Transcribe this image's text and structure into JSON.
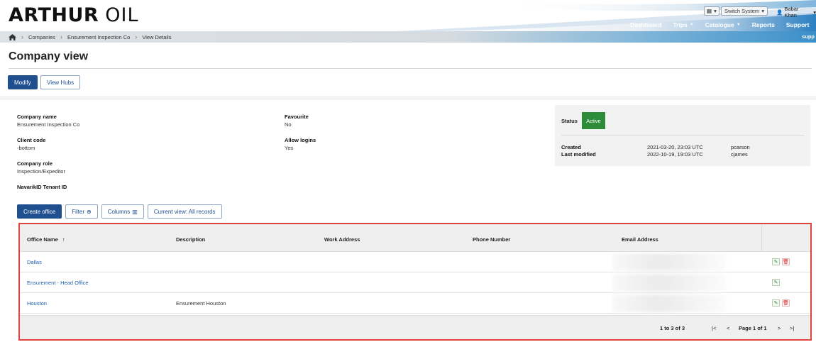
{
  "brand": {
    "logo_bold": "ARTHUR",
    "logo_thin": "OIL"
  },
  "utility": {
    "switch_system": "Switch System",
    "user_name": "Babar Khan"
  },
  "nav": [
    {
      "label": "Dashboard",
      "has_caret": false
    },
    {
      "label": "Trips",
      "has_caret": true
    },
    {
      "label": "Catalogue",
      "has_caret": true
    },
    {
      "label": "Reports",
      "has_caret": false
    },
    {
      "label": "Support",
      "has_caret": false
    }
  ],
  "breadcrumb": {
    "items": [
      "Companies",
      "Ensurement Inspection Co",
      "View Details"
    ],
    "right_text": "supp"
  },
  "page": {
    "title": "Company view",
    "modify_label": "Modify",
    "view_hubs_label": "View Hubs"
  },
  "company": {
    "name_label": "Company name",
    "name": "Ensurement Inspection Co",
    "client_code_label": "Client code",
    "client_code": "-bottom",
    "role_label": "Company role",
    "role": "Inspection/Expeditor",
    "tenant_label": "NavarikID Tenant ID",
    "favourite_label": "Favourite",
    "favourite": "No",
    "allow_logins_label": "Allow logins",
    "allow_logins": "Yes"
  },
  "status": {
    "label": "Status",
    "value": "Active",
    "color": "#2e8b3a",
    "created_label": "Created",
    "created_at": "2021-03-20, 23:03 UTC",
    "created_by": "pcarson",
    "modified_label": "Last modified",
    "modified_at": "2022-10-19, 19:03 UTC",
    "modified_by": "cjames"
  },
  "toolbar": {
    "create_office": "Create office",
    "filter": "Filter",
    "columns": "Columns",
    "current_view": "Current view: All records"
  },
  "table": {
    "columns": [
      "Office Name",
      "Description",
      "Work Address",
      "Phone Number",
      "Email Address"
    ],
    "sort_indicator": "↑",
    "rows": [
      {
        "office_name": "Dallas",
        "description": "",
        "actions": [
          "edit",
          "delete"
        ]
      },
      {
        "office_name": "Ensurement - Head Office",
        "description": "",
        "actions": [
          "edit"
        ]
      },
      {
        "office_name": "Houston",
        "description": "Ensurement Houston",
        "actions": [
          "edit",
          "delete"
        ]
      }
    ],
    "pagination": {
      "summary": "1 to 3 of 3",
      "page_label": "Page 1 of 1",
      "first": "|<",
      "prev": "<",
      "next": ">",
      "last": ">|"
    }
  },
  "colors": {
    "primary": "#1f4f8f",
    "link": "#1f5fa8",
    "highlight_border": "#e0443c"
  }
}
